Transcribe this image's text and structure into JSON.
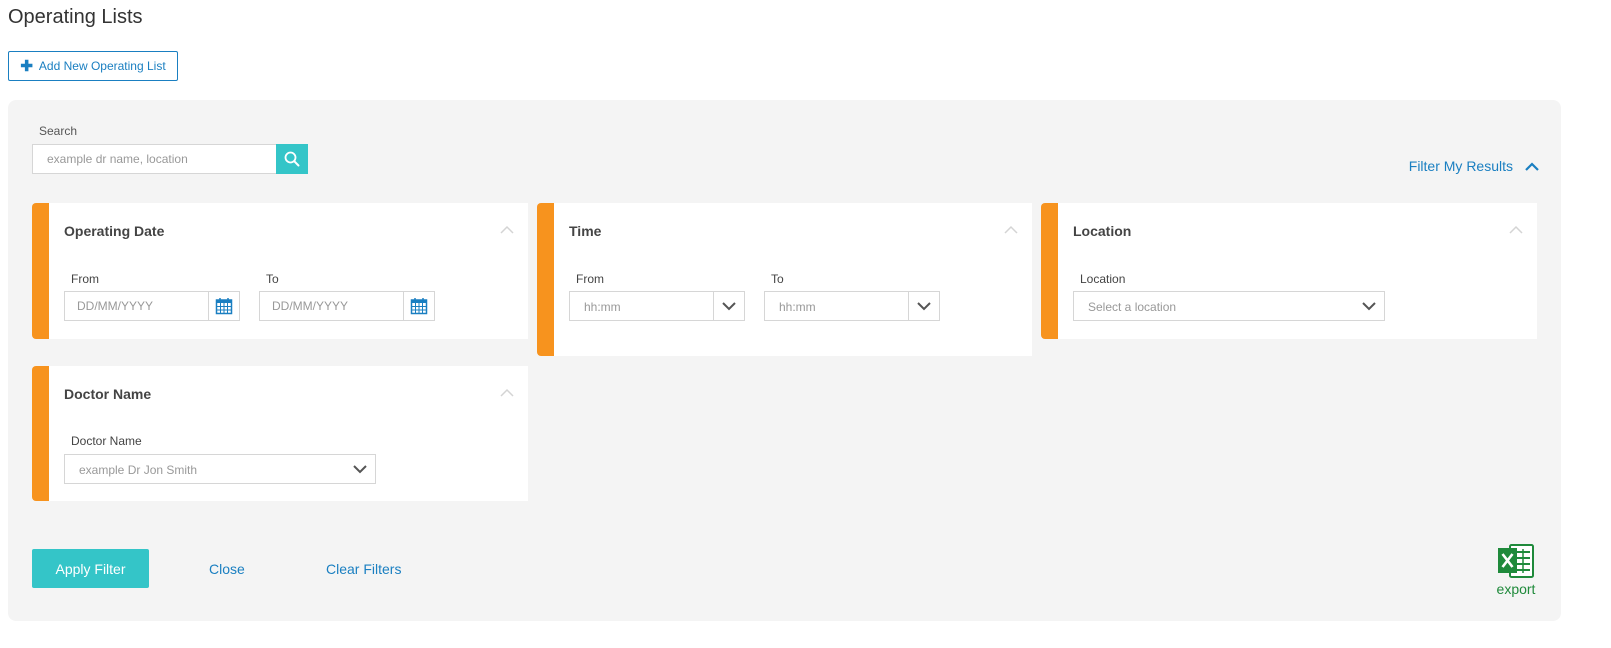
{
  "page": {
    "title": "Operating Lists"
  },
  "add_button": {
    "label": "Add New Operating List"
  },
  "search": {
    "label": "Search",
    "placeholder": "example dr name, location"
  },
  "filter_toggle": {
    "label": "Filter My Results"
  },
  "cards": {
    "operating_date": {
      "title": "Operating Date",
      "from_label": "From",
      "from_placeholder": "DD/MM/YYYY",
      "to_label": "To",
      "to_placeholder": "DD/MM/YYYY"
    },
    "time": {
      "title": "Time",
      "from_label": "From",
      "from_value": "hh:mm",
      "to_label": "To",
      "to_value": "hh:mm"
    },
    "location": {
      "title": "Location",
      "field_label": "Location",
      "value": "Select a location"
    },
    "doctor": {
      "title": "Doctor Name",
      "field_label": "Doctor Name",
      "value": "example Dr Jon Smith"
    }
  },
  "actions": {
    "apply": "Apply Filter",
    "close": "Close",
    "clear": "Clear Filters",
    "export": "export"
  },
  "icons": {
    "add": "plus-icon",
    "search": "search-icon",
    "collapse": "chevron-up-icon",
    "calendar": "calendar-icon",
    "dropdown": "chevron-down-icon",
    "export": "excel-icon"
  },
  "colors": {
    "accent_teal": "#34c5c8",
    "link_blue": "#1a7fc1",
    "card_border_orange": "#f7931e",
    "excel_green": "#1f8a3b"
  }
}
